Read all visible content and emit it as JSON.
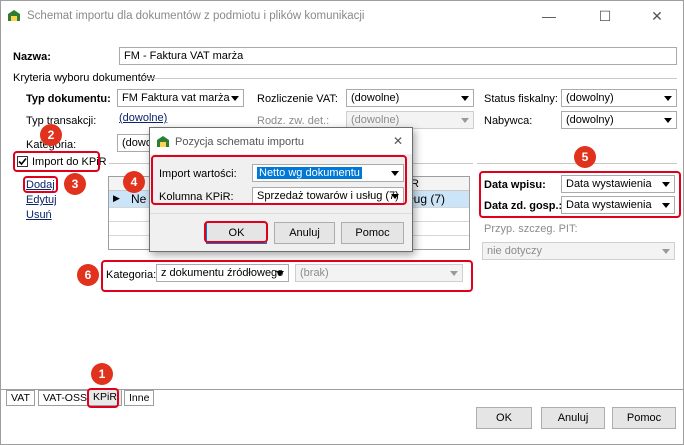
{
  "window": {
    "title": "Schemat importu dla dokumentów z podmiotu i plików komunikacji",
    "minimize": "—",
    "maximize": "☐",
    "close": "✕",
    "icon": "app-logo-icon"
  },
  "form": {
    "name_label": "Nazwa:",
    "name_value": "FM - Faktura VAT marża",
    "criteria_label": "Kryteria wyboru dokumentów",
    "doc_type_label": "Typ dokumentu:",
    "doc_type_value": "FM Faktura vat marża",
    "vat_settlement_label": "Rozliczenie VAT:",
    "vat_settlement_value": "(dowolne)",
    "fiscal_status_label": "Status fiskalny:",
    "fiscal_status_value": "(dowolny)",
    "transaction_type_label": "Typ transakcji:",
    "transaction_type_value": "(dowolne)",
    "activity_type_label": "Rodz. zw. det.:",
    "activity_type_value": "(dowolne)",
    "buyer_label": "Nabywca:",
    "buyer_value": "(dowolny)",
    "category_label": "Kategoria:",
    "category_value": "(dowolna)"
  },
  "kpir": {
    "import_checkbox_label": "Import do KPiR",
    "import_checked": true,
    "add_link": "Dodaj",
    "edit_link": "Edytuj",
    "delete_link": "Usuń",
    "grid_header_right": "R",
    "grid_row_arrow": "▶",
    "grid_row_left": "Ne",
    "grid_row_right": "ług (7)",
    "entry_date_label": "Data wpisu:",
    "entry_date_value": "Data wystawienia",
    "event_date_label": "Data zd. gosp.:",
    "event_date_value": "Data wystawienia",
    "pit_label": "Przyp. szczeg. PIT:",
    "pit_value": "nie dotyczy",
    "category_label": "Kategoria:",
    "category_source_value": "z dokumentu źródłowego",
    "category_value": "(brak)"
  },
  "tabs": [
    "VAT",
    "VAT-OSS",
    "KPiR",
    "Inne"
  ],
  "active_tab": "KPiR",
  "footer": {
    "ok": "OK",
    "cancel": "Anuluj",
    "help": "Pomoc"
  },
  "dialog": {
    "title": "Pozycja schematu importu",
    "close": "✕",
    "import_value_label": "Import wartości:",
    "import_value": "Netto wg dokumentu",
    "kpir_column_label": "Kolumna KPiR:",
    "kpir_column_value": "Sprzedaż towarów i usług (7)",
    "ok": "OK",
    "cancel": "Anuluj",
    "help": "Pomoc"
  },
  "badges": [
    "1",
    "2",
    "3",
    "4",
    "5",
    "6"
  ],
  "colors": {
    "highlight_red": "#e0001b",
    "badge_red": "#e0321c",
    "selection_blue": "#0078d7",
    "grid_row_blue": "#cce4f7"
  }
}
